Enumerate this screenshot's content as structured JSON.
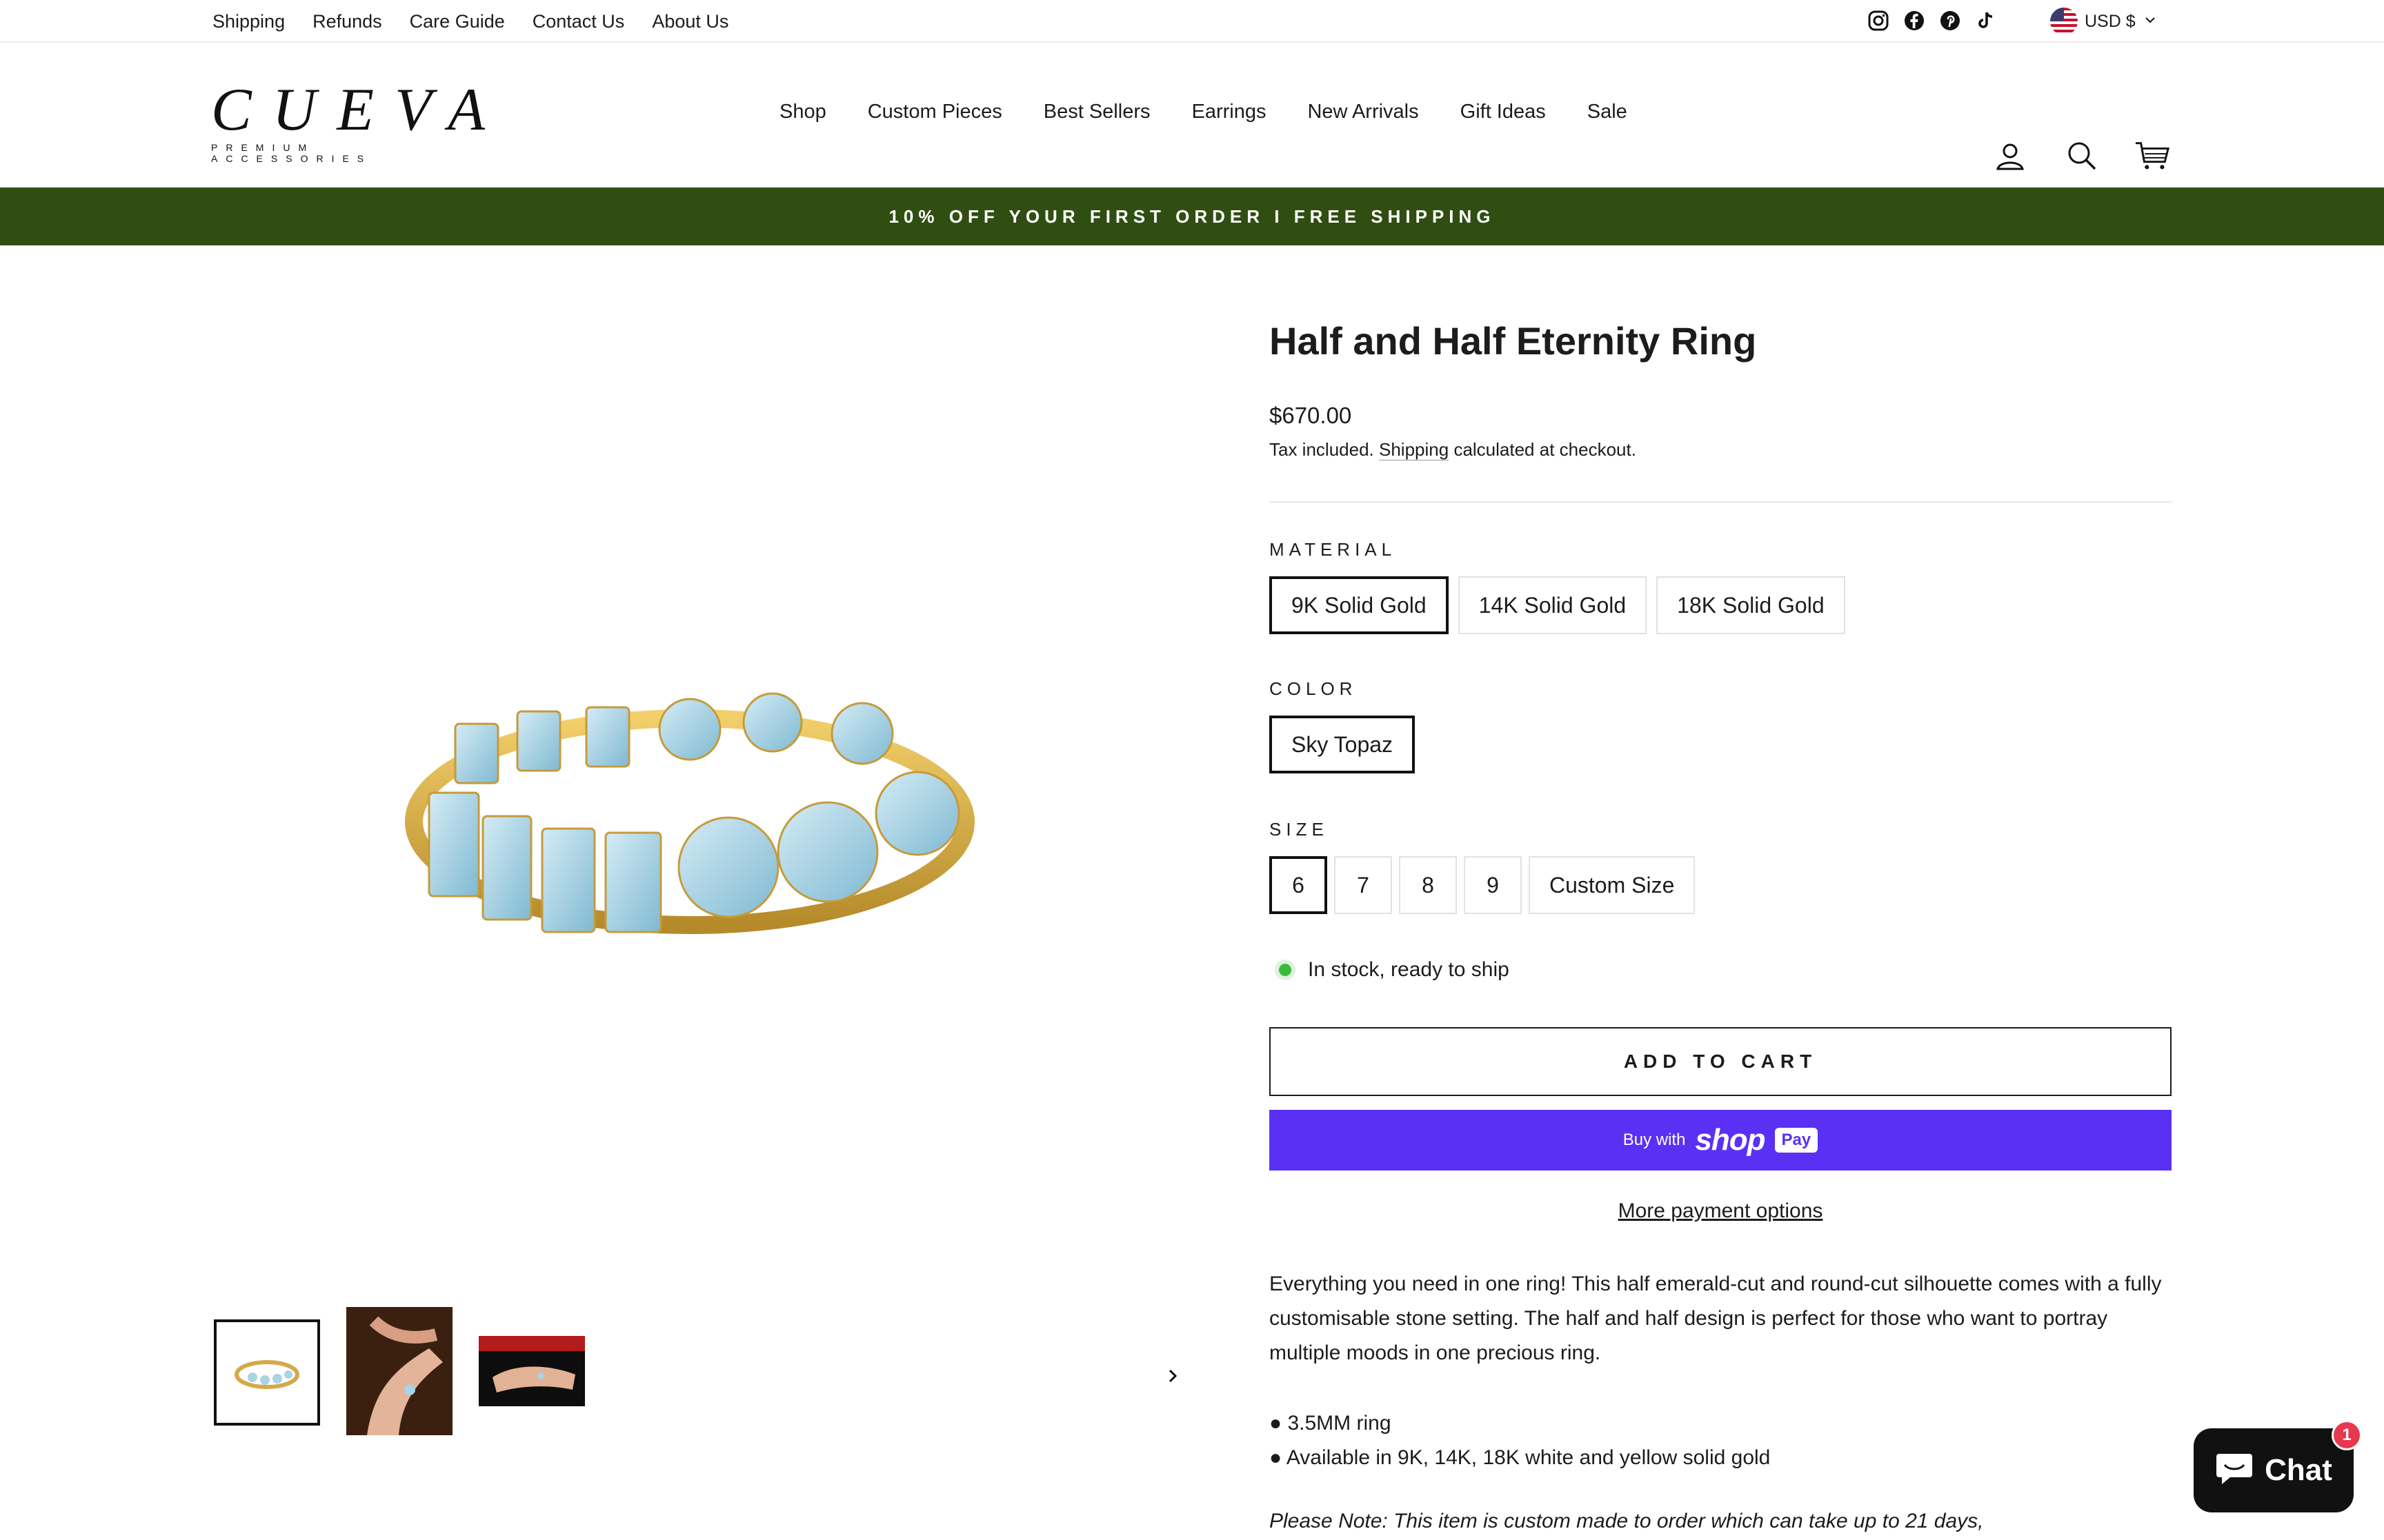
{
  "utility_bar": {
    "links": [
      "Shipping",
      "Refunds",
      "Care Guide",
      "Contact Us",
      "About Us"
    ],
    "social_icons": [
      "instagram-icon",
      "facebook-icon",
      "pinterest-icon",
      "tiktok-icon"
    ],
    "currency": "USD $"
  },
  "header": {
    "logo_word": "CUEVA",
    "logo_tagline": "PREMIUM ACCESSORIES",
    "nav": [
      "Shop",
      "Custom Pieces",
      "Best Sellers",
      "Earrings",
      "New Arrivals",
      "Gift Ideas",
      "Sale"
    ],
    "icons": [
      "account-icon",
      "search-icon",
      "cart-icon"
    ]
  },
  "promo": "10% OFF YOUR FIRST ORDER I FREE SHIPPING",
  "product": {
    "title": "Half and Half Eternity Ring",
    "price": "$670.00",
    "tax_prefix": "Tax included.",
    "tax_link": "Shipping",
    "tax_suffix": "calculated at checkout.",
    "material": {
      "label": "MATERIAL",
      "options": [
        "9K Solid Gold",
        "14K Solid Gold",
        "18K Solid Gold"
      ],
      "selected": "9K Solid Gold"
    },
    "color": {
      "label": "COLOR",
      "options": [
        "Sky Topaz"
      ],
      "selected": "Sky Topaz"
    },
    "size": {
      "label": "SIZE",
      "options": [
        "6",
        "7",
        "8",
        "9",
        "Custom Size"
      ],
      "selected": "6"
    },
    "stock": "In stock, ready to ship",
    "add_to_cart": "ADD TO CART",
    "shop_pay_prefix": "Buy with",
    "shop_pay_brand": "shop",
    "shop_pay_pay": "Pay",
    "more_payment": "More payment options",
    "description": "Everything you need in one ring! This half emerald-cut and round-cut silhouette comes with a fully customisable stone setting. The half and half design is perfect for those who want to portray multiple moods in one precious ring.",
    "bullets": [
      "3.5MM ring",
      "Available in 9K, 14K, 18K white and yellow solid gold"
    ],
    "note": "Please Note: This item is custom made to order which can take up to 21 days,"
  },
  "chat": {
    "label": "Chat",
    "badge": "1"
  },
  "colors": {
    "promo_bg": "#314e12",
    "shop_pay": "#5a31f4",
    "stock_dot": "#3bbb3b",
    "chat_badge": "#e8384f"
  }
}
